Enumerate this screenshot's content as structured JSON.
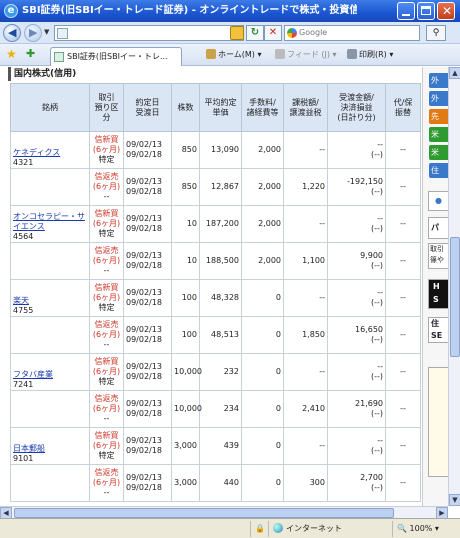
{
  "window": {
    "title": "SBI証券(旧SBIイー・トレード証券) - オンライントレードで株式・投資信託・債券を - - Win..."
  },
  "address": {
    "url": "",
    "search_placeholder": "Google"
  },
  "tab": {
    "label": "SBI証券(旧SBIイー・トレ..."
  },
  "command_bar": {
    "home": "ホーム(M)",
    "feed": "フィード (J)",
    "print": "印刷(R)"
  },
  "section_title": "国内株式(信用)",
  "table": {
    "headers": [
      "銘柄",
      "取引\n預り区\n分",
      "約定日\n受渡日",
      "株数",
      "平均約定\n単価",
      "手数料/\n諸経費等",
      "課税額/\n譲渡益税",
      "受渡金額/\n決済損益\n(日計り分)",
      "代/保\n振替"
    ],
    "rows": [
      {
        "name": "ケネディクス",
        "code": "4321",
        "kind": "信新買",
        "term": "(6ヶ月)",
        "acct": "特定",
        "date": "09/02/13\n09/02/18",
        "qty": "850",
        "price": "13,090",
        "fee": "2,000",
        "tax": "--",
        "pl": "--\n(--)",
        "tr": "--"
      },
      {
        "name": "",
        "code": "",
        "kind": "信返売",
        "term": "(6ヶ月)",
        "acct": "--",
        "date": "09/02/13\n09/02/18",
        "qty": "850",
        "price": "12,867",
        "fee": "2,000",
        "tax": "1,220",
        "pl": "-192,150\n(--)",
        "tr": "--"
      },
      {
        "name": "オンコセラピー・サイエンス",
        "code": "4564",
        "kind": "信新買",
        "term": "(6ヶ月)",
        "acct": "特定",
        "date": "09/02/13\n09/02/18",
        "qty": "10",
        "price": "187,200",
        "fee": "2,000",
        "tax": "--",
        "pl": "--\n(--)",
        "tr": "--"
      },
      {
        "name": "",
        "code": "",
        "kind": "信返売",
        "term": "(6ヶ月)",
        "acct": "--",
        "date": "09/02/13\n09/02/18",
        "qty": "10",
        "price": "188,500",
        "fee": "2,000",
        "tax": "1,100",
        "pl": "9,900\n(--)",
        "tr": "--"
      },
      {
        "name": "楽天",
        "code": "4755",
        "kind": "信新買",
        "term": "(6ヶ月)",
        "acct": "特定",
        "date": "09/02/13\n09/02/18",
        "qty": "100",
        "price": "48,328",
        "fee": "0",
        "tax": "--",
        "pl": "--\n(--)",
        "tr": "--"
      },
      {
        "name": "",
        "code": "",
        "kind": "信返売",
        "term": "(6ヶ月)",
        "acct": "--",
        "date": "09/02/13\n09/02/18",
        "qty": "100",
        "price": "48,513",
        "fee": "0",
        "tax": "1,850",
        "pl": "16,650\n(--)",
        "tr": "--"
      },
      {
        "name": "フタバ産業",
        "code": "7241",
        "kind": "信新買",
        "term": "(6ヶ月)",
        "acct": "特定",
        "date": "09/02/13\n09/02/18",
        "qty": "10,000",
        "price": "232",
        "fee": "0",
        "tax": "--",
        "pl": "--\n(--)",
        "tr": "--"
      },
      {
        "name": "",
        "code": "",
        "kind": "信返売",
        "term": "(6ヶ月)",
        "acct": "--",
        "date": "09/02/13\n09/02/18",
        "qty": "10,000",
        "price": "234",
        "fee": "0",
        "tax": "2,410",
        "pl": "21,690\n(--)",
        "tr": "--"
      },
      {
        "name": "日本郵船",
        "code": "9101",
        "kind": "信新買",
        "term": "(6ヶ月)",
        "acct": "特定",
        "date": "09/02/13\n09/02/18",
        "qty": "3,000",
        "price": "439",
        "fee": "0",
        "tax": "--",
        "pl": "--\n(--)",
        "tr": "--"
      },
      {
        "name": "",
        "code": "",
        "kind": "信返売",
        "term": "(6ヶ月)",
        "acct": "--",
        "date": "09/02/13\n09/02/18",
        "qty": "3,000",
        "price": "440",
        "fee": "0",
        "tax": "300",
        "pl": "2,700\n(--)",
        "tr": "--"
      }
    ]
  },
  "side_panel": {
    "tags": [
      "外",
      "外",
      "先",
      "米",
      "米",
      "住"
    ],
    "tag_colors": [
      "#3a78c9",
      "#3a78c9",
      "#e07a12",
      "#2f9a2f",
      "#2f9a2f",
      "#3a78c9"
    ],
    "box1": "パ",
    "box2": "取引\n篠や",
    "box3": "H\nS",
    "box4": "住\nSE"
  },
  "status": {
    "zone": "インターネット",
    "zoom": "100%"
  },
  "colors": {
    "titlebar": "#1a56d1",
    "header_bg": "#dbe6f5",
    "link": "#1a3bb0",
    "trade_kind": "#c32"
  }
}
